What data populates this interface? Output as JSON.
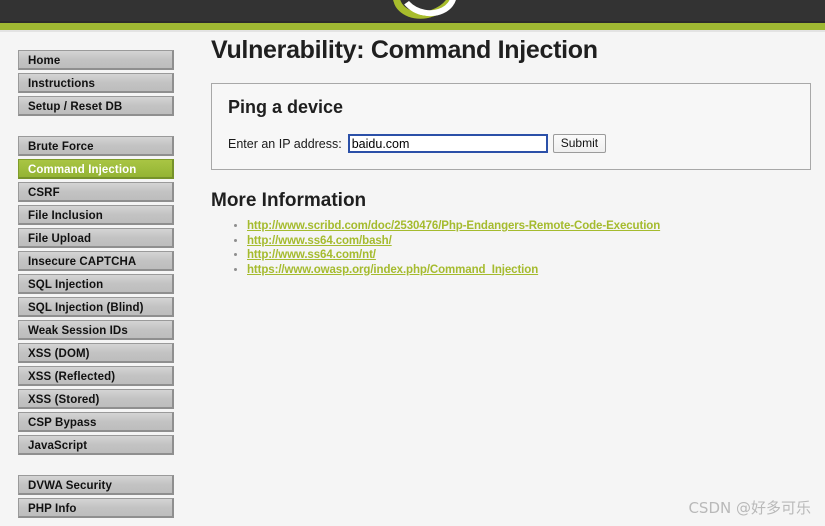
{
  "header": {
    "logo_name": "dvwa-logo",
    "bar_color": "#333333",
    "stripe_color": "#9fb832"
  },
  "sidebar": {
    "groups": [
      {
        "items": [
          {
            "label": "Home",
            "active": false
          },
          {
            "label": "Instructions",
            "active": false
          },
          {
            "label": "Setup / Reset DB",
            "active": false
          }
        ]
      },
      {
        "items": [
          {
            "label": "Brute Force",
            "active": false
          },
          {
            "label": "Command Injection",
            "active": true
          },
          {
            "label": "CSRF",
            "active": false
          },
          {
            "label": "File Inclusion",
            "active": false
          },
          {
            "label": "File Upload",
            "active": false
          },
          {
            "label": "Insecure CAPTCHA",
            "active": false
          },
          {
            "label": "SQL Injection",
            "active": false
          },
          {
            "label": "SQL Injection (Blind)",
            "active": false
          },
          {
            "label": "Weak Session IDs",
            "active": false
          },
          {
            "label": "XSS (DOM)",
            "active": false
          },
          {
            "label": "XSS (Reflected)",
            "active": false
          },
          {
            "label": "XSS (Stored)",
            "active": false
          },
          {
            "label": "CSP Bypass",
            "active": false
          },
          {
            "label": "JavaScript",
            "active": false
          }
        ]
      },
      {
        "items": [
          {
            "label": "DVWA Security",
            "active": false
          },
          {
            "label": "PHP Info",
            "active": false
          }
        ]
      }
    ],
    "active_color": "#9cbb3a"
  },
  "main": {
    "page_title": "Vulnerability: Command Injection",
    "panel": {
      "title": "Ping a device",
      "field_label": "Enter an IP address:",
      "input_value": "baidu.com",
      "input_placeholder": "",
      "submit_label": "Submit",
      "focus_border_color": "#2b50a8"
    },
    "more_information": {
      "title": "More Information",
      "links": [
        "http://www.scribd.com/doc/2530476/Php-Endangers-Remote-Code-Execution",
        "http://www.ss64.com/bash/",
        "http://www.ss64.com/nt/",
        "https://www.owasp.org/index.php/Command_Injection"
      ],
      "link_color": "#a5bb2e"
    }
  },
  "watermark": {
    "text": "CSDN @好多可乐"
  }
}
